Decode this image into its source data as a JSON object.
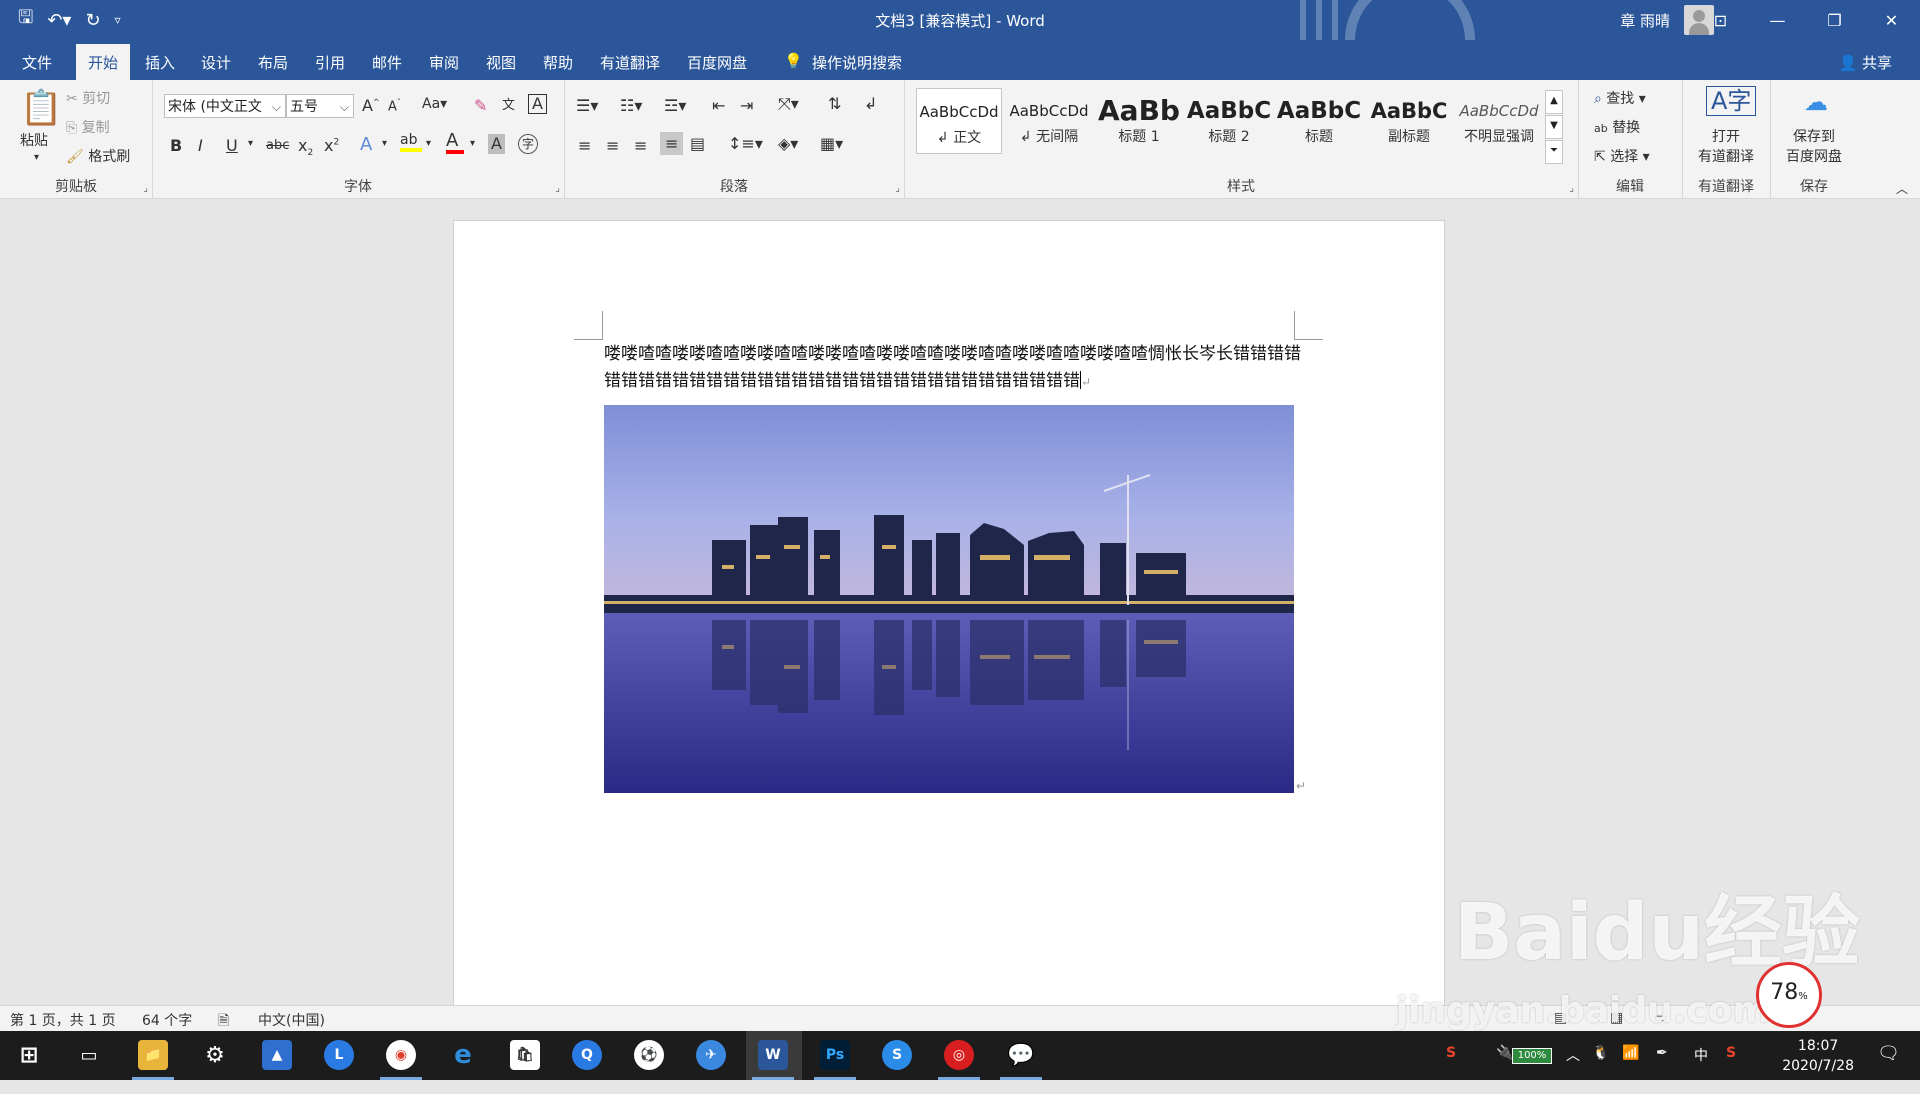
{
  "window": {
    "title": "文档3 [兼容模式]  -  Word",
    "user": "章 雨晴",
    "share": "共享"
  },
  "qat": {
    "save_icon": "save-icon",
    "undo_icon": "undo-icon",
    "redo_icon": "redo-icon",
    "customize_icon": "chevron-down-icon"
  },
  "tabs": [
    "文件",
    "开始",
    "插入",
    "设计",
    "布局",
    "引用",
    "邮件",
    "审阅",
    "视图",
    "帮助",
    "有道翻译",
    "百度网盘"
  ],
  "active_tab": "开始",
  "tell_me": "操作说明搜索",
  "ribbon": {
    "clipboard": {
      "paste": "粘贴",
      "cut": "剪切",
      "copy": "复制",
      "format_painter": "格式刷",
      "label": "剪贴板"
    },
    "font": {
      "name": "宋体 (中文正文",
      "size": "五号",
      "case": "Aa",
      "label": "字体",
      "highlight_color": "#ffff00",
      "font_color": "#ff0000"
    },
    "paragraph": {
      "label": "段落"
    },
    "styles": {
      "label": "样式",
      "items": [
        {
          "preview": "AaBbCcDd",
          "name": "↲ 正文"
        },
        {
          "preview": "AaBbCcDd",
          "name": "↲ 无间隔"
        },
        {
          "preview": "AaBb",
          "name": "标题 1"
        },
        {
          "preview": "AaBbC",
          "name": "标题 2"
        },
        {
          "preview": "AaBbC",
          "name": "标题"
        },
        {
          "preview": "AaBbC",
          "name": "副标题"
        },
        {
          "preview": "AaBbCcDd",
          "name": "不明显强调"
        }
      ]
    },
    "editing": {
      "find": "查找",
      "replace": "替换",
      "select": "选择",
      "label": "编辑"
    },
    "youdao": {
      "open": "打开",
      "open2": "有道翻译",
      "label": "有道翻译"
    },
    "baidu": {
      "save": "保存到",
      "save2": "百度网盘",
      "label": "保存"
    }
  },
  "document": {
    "paragraph": "喽喽喳喳喽喽喳喳喽喽喳喳喽喽喳喳喽喽喳喳喽喽喳喳喽喽喳喳喽喽喳喳惆怅长岑长错错错错错错错错错错错错错错错错错错错错错错错错错错错错错错错错"
  },
  "statusbar": {
    "page": "第 1 页，共 1 页",
    "words": "64 个字",
    "language": "中文(中国)"
  },
  "taskbar": {
    "clock_time": "18:07",
    "clock_date": "2020/7/28",
    "battery": "100%",
    "ime": "中",
    "net_speed": "78",
    "net_unit": "%"
  },
  "watermark": {
    "text": "Baidu经验",
    "sub": "jingyan.baidu.com"
  },
  "colors": {
    "accent": "#2b579a",
    "ribbon_bg": "#f3f3f3",
    "page_bg": "#ffffff",
    "taskbar": "#1c1c1c"
  }
}
